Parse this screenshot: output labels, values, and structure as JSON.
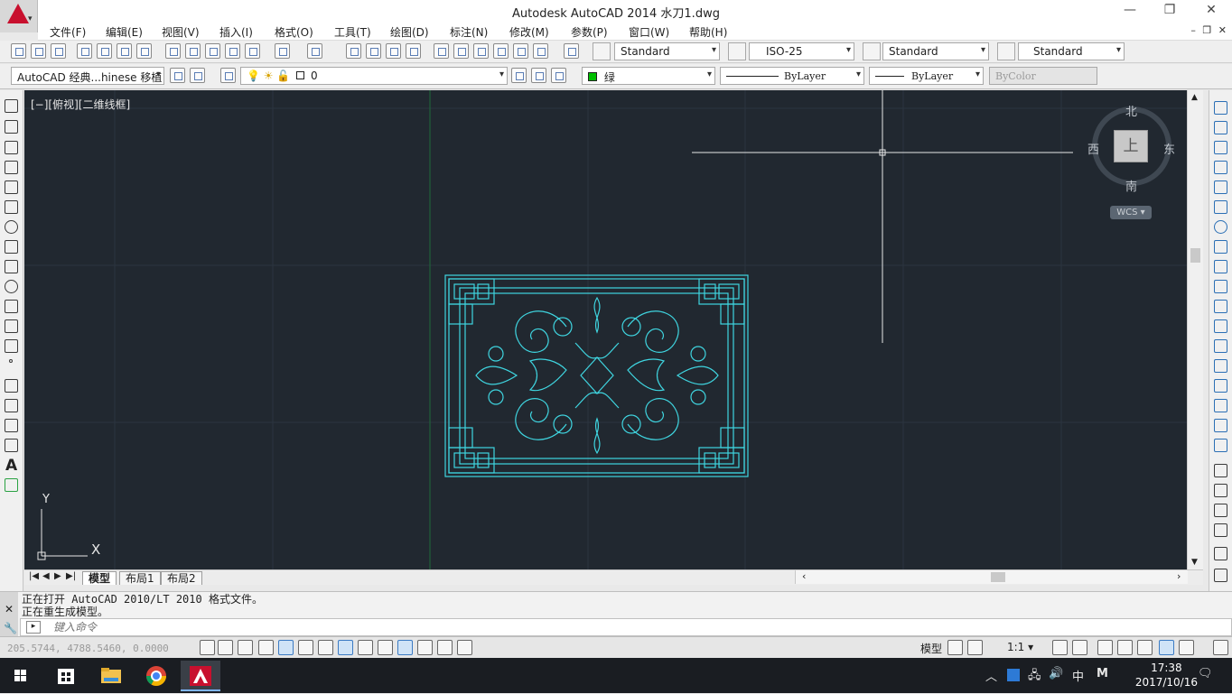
{
  "window": {
    "title": "Autodesk AutoCAD 2014     水刀1.dwg",
    "controls": {
      "minimize": "—",
      "restore": "❐",
      "close": "✕"
    },
    "logo_dropdown": "▾"
  },
  "menu": {
    "items": [
      "文件(F)",
      "编辑(E)",
      "视图(V)",
      "插入(I)",
      "格式(O)",
      "工具(T)",
      "绘图(D)",
      "标注(N)",
      "修改(M)",
      "参数(P)",
      "窗口(W)",
      "帮助(H)"
    ],
    "doc_controls": "– ❐ ✕"
  },
  "styles_toolbar": {
    "text_style": "Standard",
    "dim_style": "ISO-25",
    "table_style": "Standard",
    "mleader_style": "Standard"
  },
  "layer_toolbar": {
    "workspace": "AutoCAD 经典...hinese 移植",
    "layer_name": "0",
    "color": "绿",
    "color_hex": "#00c000",
    "linetype": "ByLayer",
    "lineweight": "ByLayer",
    "plot_style": "ByColor"
  },
  "viewport": {
    "label": "[−][俯视][二维线框]",
    "background": "#212830",
    "drawing_color": "#3fd5e0",
    "ucs": {
      "x": "X",
      "y": "Y"
    },
    "viewcube": {
      "top": "上",
      "north": "北",
      "south": "南",
      "east": "东",
      "west": "西",
      "wcs": "WCS ▾"
    }
  },
  "layout_tabs": [
    "模型",
    "布局1",
    "布局2"
  ],
  "tab_nav": [
    "|◀",
    "◀",
    "▶",
    "▶|"
  ],
  "command": {
    "history": [
      "正在打开 AutoCAD 2010/LT 2010 格式文件。",
      "正在重生成模型。"
    ],
    "placeholder": "键入命令",
    "prompt_icon": "▸"
  },
  "status": {
    "coords": "205.5744, 4788.5460, 0.0000",
    "model_label": "模型",
    "scale": "1:1 ▾"
  },
  "taskbar": {
    "time": "17:38",
    "date": "2017/10/16",
    "ime": "中",
    "ime2": "M"
  }
}
